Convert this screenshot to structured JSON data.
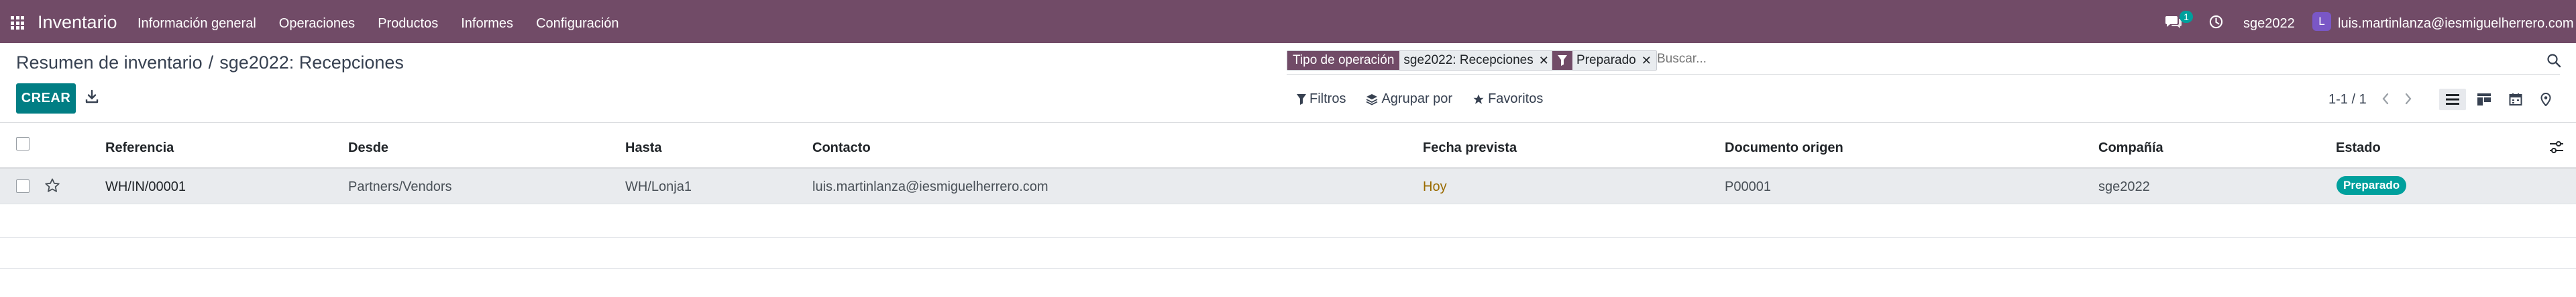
{
  "navbar": {
    "brand": "Inventario",
    "menu": [
      "Información general",
      "Operaciones",
      "Productos",
      "Informes",
      "Configuración"
    ],
    "chat_count": "1",
    "db_name": "sge2022",
    "avatar_initial": "L",
    "user_email": "luis.martinlanza@iesmiguelherrero.com",
    "color": "#714b67"
  },
  "breadcrumb": {
    "parent": "Resumen de inventario",
    "separator": "/",
    "current": "sge2022: Recepciones"
  },
  "search": {
    "facets": [
      {
        "label": "Tipo de operación",
        "value": "sge2022: Recepciones"
      },
      {
        "icon": "filter-icon",
        "value": "Preparado"
      }
    ],
    "placeholder": "Buscar..."
  },
  "toolbar": {
    "create_label": "CREAR",
    "accent": "#017e84"
  },
  "filters": {
    "filtros": "Filtros",
    "agrupar": "Agrupar por",
    "favoritos": "Favoritos"
  },
  "pager": {
    "value": "1-1 / 1"
  },
  "views": [
    "list-view-icon",
    "kanban-view-icon",
    "calendar-view-icon",
    "map-view-icon"
  ],
  "table": {
    "columns": [
      "Referencia",
      "Desde",
      "Hasta",
      "Contacto",
      "Fecha prevista",
      "Documento origen",
      "Compañía",
      "Estado"
    ],
    "rows": [
      {
        "referencia": "WH/IN/00001",
        "desde": "Partners/Vendors",
        "hasta": "WH/Lonja1",
        "contacto": "luis.martinlanza@iesmiguelherrero.com",
        "fecha": "Hoy",
        "origen": "P00001",
        "compania": "sge2022",
        "estado": "Preparado"
      }
    ],
    "status_color": "#00a09d",
    "date_color": "#9a6b00"
  }
}
